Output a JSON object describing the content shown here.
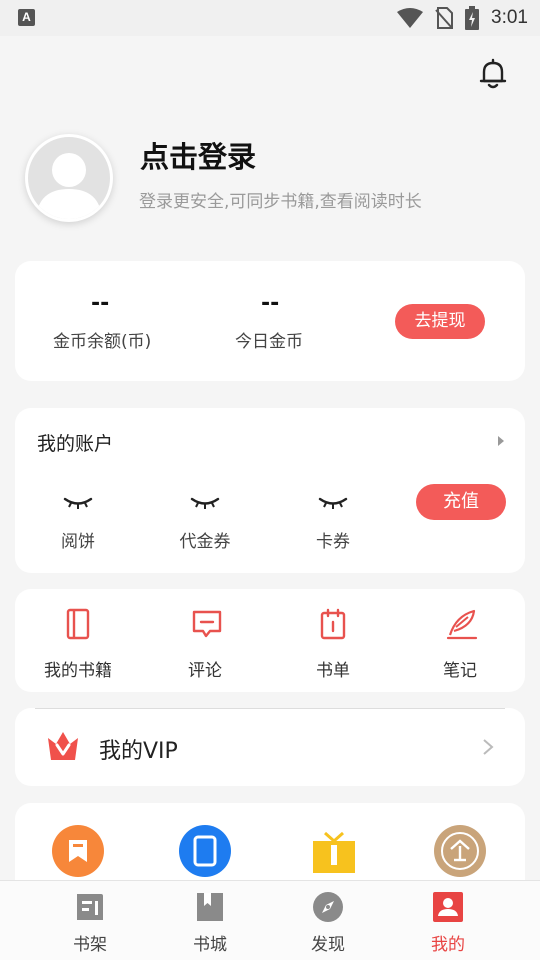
{
  "status_bar": {
    "time": "3:01",
    "app_badge": "A"
  },
  "profile": {
    "login_title": "点击登录",
    "login_subtitle": "登录更安全,可同步书籍,查看阅读时长"
  },
  "coins": {
    "balance_value": "--",
    "balance_label": "金币余额(币)",
    "today_value": "--",
    "today_label": "今日金币",
    "withdraw_label": "去提现"
  },
  "account": {
    "title": "我的账户",
    "items": [
      {
        "label": "阅饼"
      },
      {
        "label": "代金券"
      },
      {
        "label": "卡券"
      }
    ],
    "recharge_label": "充值"
  },
  "shelf_menu": [
    {
      "label": "我的书籍",
      "icon": "book-icon"
    },
    {
      "label": "评论",
      "icon": "comment-icon"
    },
    {
      "label": "书单",
      "icon": "booklist-icon"
    },
    {
      "label": "笔记",
      "icon": "quill-icon"
    }
  ],
  "vip": {
    "label": "我的VIP"
  },
  "tools": [
    {
      "icon": "bookmark-icon",
      "color": "#f7873a"
    },
    {
      "icon": "phone-icon",
      "color": "#1e7cf0"
    },
    {
      "icon": "gift-icon",
      "color": "#f7c21e"
    },
    {
      "icon": "enterprise-coin-icon",
      "color": "#c9a47a"
    }
  ],
  "tabbar": [
    {
      "label": "书架",
      "icon": "bookshelf-icon",
      "active": false
    },
    {
      "label": "书城",
      "icon": "bookstore-icon",
      "active": false
    },
    {
      "label": "发现",
      "icon": "compass-icon",
      "active": false
    },
    {
      "label": "我的",
      "icon": "profile-icon",
      "active": true
    }
  ],
  "colors": {
    "accent": "#f35b59",
    "active_tab": "#e84443",
    "background": "#f5f5f5"
  }
}
